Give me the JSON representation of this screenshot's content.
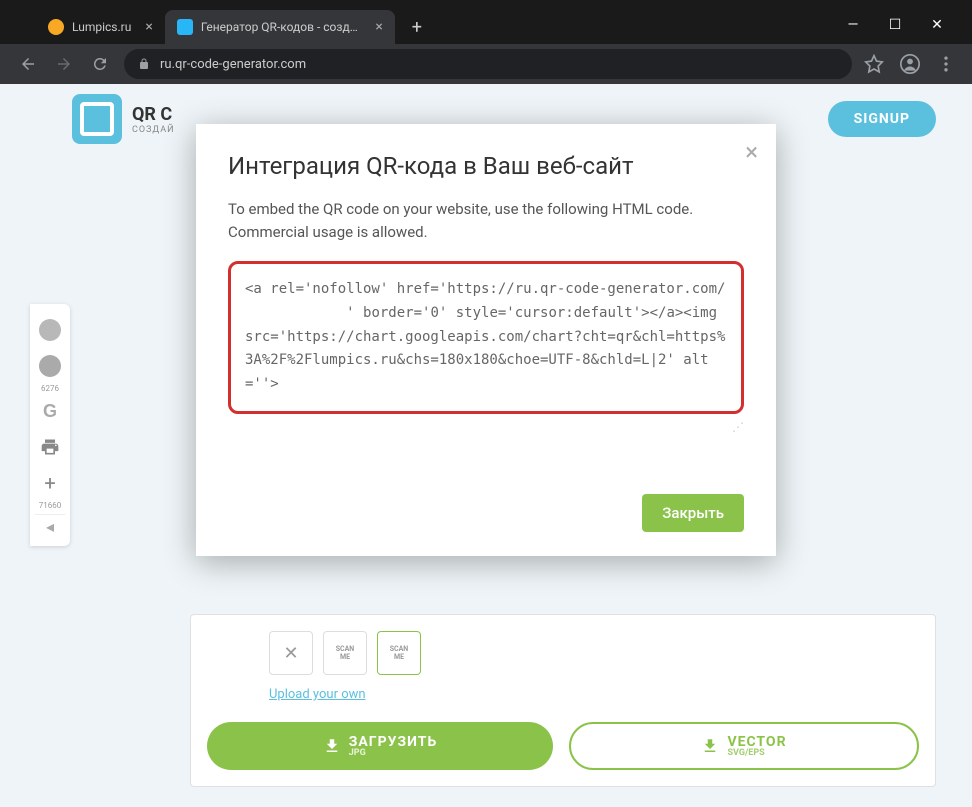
{
  "window": {
    "tabs": [
      {
        "title": "Lumpics.ru",
        "active": false
      },
      {
        "title": "Генератор QR-кодов - создавай",
        "active": true
      }
    ]
  },
  "address": {
    "url": "ru.qr-code-generator.com"
  },
  "header": {
    "logo_title": "QR С",
    "logo_sub": "СОЗДАЙ",
    "signup": "SIGNUP"
  },
  "side": {
    "fb_count": "6276",
    "plus_count": "71660"
  },
  "panel": {
    "scan_label": "SCAN",
    "me_label": "ME",
    "upload": "Upload your own",
    "download": "ЗАГРУЗИТЬ",
    "jpg": "JPG",
    "vector": "VECTOR",
    "svg": "SVG/EPS"
  },
  "modal": {
    "title": "Интеграция QR-кода в Ваш веб-сайт",
    "desc": "To embed the QR code on your website, use the following HTML code. Commercial usage is allowed.",
    "code": "<a rel='nofollow' href='https://ru.qr-code-generator.com/\n            ' border='0' style='cursor:default'></a><img src='https://chart.googleapis.com/chart?cht=qr&chl=https%3A%2F%2Flumpics.ru&chs=180x180&choe=UTF-8&chld=L|2' alt=''>",
    "close": "Закрыть"
  }
}
